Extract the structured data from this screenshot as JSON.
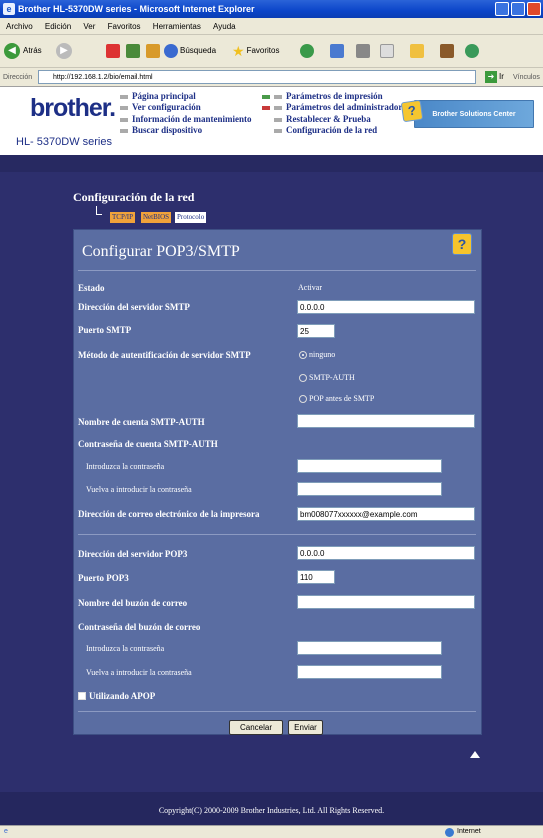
{
  "window": {
    "title": "Brother HL-5370DW series - Microsoft Internet Explorer"
  },
  "menu": [
    "Archivo",
    "Edición",
    "Ver",
    "Favoritos",
    "Herramientas",
    "Ayuda"
  ],
  "toolbar": {
    "back": "Atrás",
    "search": "Búsqueda",
    "favorites": "Favoritos"
  },
  "address": {
    "label": "Dirección",
    "url": "http://192.168.1.2/bio/email.html",
    "go": "Ir",
    "links": "Vínculos"
  },
  "header": {
    "logo": "brother.",
    "model": "HL- 5370DW series",
    "nav_left": [
      "Página principal",
      "Ver configuración",
      "Información de mantenimiento",
      "Buscar dispositivo"
    ],
    "nav_right": [
      "Parámetros de impresión",
      "Parámetros del administrador",
      "Restablecer & Prueba",
      "Configuración de la red"
    ],
    "solutions": "Brother Solutions Center"
  },
  "section": {
    "title": "Configuración de la red",
    "tabs": [
      "TCP/IP",
      "NetBIOS",
      "Protocolo"
    ]
  },
  "form": {
    "title": "Configurar POP3/SMTP",
    "estado_label": "Estado",
    "estado_value": "Activar",
    "smtp_server_label": "Dirección del servidor SMTP",
    "smtp_server_value": "0.0.0.0",
    "smtp_port_label": "Puerto SMTP",
    "smtp_port_value": "25",
    "auth_label": "Método de autentificación de servidor SMTP",
    "auth_options": [
      "ninguno",
      "SMTP-AUTH",
      "POP antes de SMTP"
    ],
    "auth_selected": "ninguno",
    "smtp_account_label": "Nombre de cuenta SMTP-AUTH",
    "smtp_account_value": "",
    "smtp_password_label": "Contraseña de cuenta SMTP-AUTH",
    "enter_password_label": "Introduzca la contraseña",
    "reenter_password_label": "Vuelva a introducir la contraseña",
    "printer_email_label": "Dirección de correo electrónico de la impresora",
    "printer_email_value": "bm008077xxxxxx@example.com",
    "pop3_server_label": "Dirección del servidor POP3",
    "pop3_server_value": "0.0.0.0",
    "pop3_port_label": "Puerto POP3",
    "pop3_port_value": "110",
    "mailbox_name_label": "Nombre del buzón de correo",
    "mailbox_name_value": "",
    "mailbox_password_label": "Contraseña del buzón de correo",
    "apop_label": "Utilizando APOP",
    "cancel_label": "Cancelar",
    "submit_label": "Enviar"
  },
  "footer": {
    "copyright": "Copyright(C) 2000-2009 Brother Industries, Ltd. All Rights Reserved."
  },
  "status": {
    "zone": "Internet"
  },
  "colors": {
    "panel": "#5a6da2",
    "page_bg": "#2d2f6d",
    "brand": "#1d2f86",
    "tab_orange": "#f0a23a"
  }
}
